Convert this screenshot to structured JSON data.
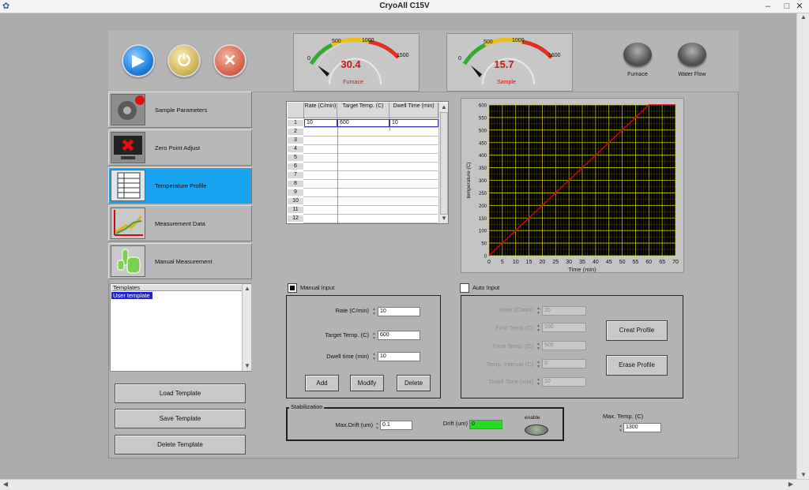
{
  "window": {
    "title": "CryoAll C15V"
  },
  "toolbar": {
    "run": "run",
    "power": "power",
    "stop": "stop"
  },
  "gauges": {
    "furnace": {
      "value": "30.4",
      "label": "Furnace",
      "ticks": [
        "0",
        "500",
        "1000",
        "1500"
      ],
      "reading": 30.4,
      "max": 1500
    },
    "sample": {
      "value": "15.7",
      "label": "Sample",
      "ticks": [
        "0",
        "500",
        "1000",
        "1600"
      ],
      "reading": 15.7,
      "max": 1600
    }
  },
  "indicators": {
    "furnace": "Furnace",
    "water_flow": "Water Flow"
  },
  "nav": {
    "items": [
      {
        "label": "Sample Parameters"
      },
      {
        "label": "Zero Point Adjust"
      },
      {
        "label": "Temperature Profile"
      },
      {
        "label": "Measurement Data"
      },
      {
        "label": "Manual Measurement"
      }
    ]
  },
  "templates": {
    "header": "Templates",
    "items": [
      "User template"
    ],
    "load": "Load Template",
    "save": "Save Template",
    "delete": "Delete Template"
  },
  "profile_table": {
    "headers": [
      "Rate (C/min)",
      "Target Temp. (C)",
      "Dwell Time (min)"
    ],
    "row_numbers": [
      "1",
      "2",
      "3",
      "4",
      "5",
      "6",
      "7",
      "8",
      "9",
      "10",
      "11",
      "12"
    ],
    "rows": [
      {
        "rate": "10",
        "target": "600",
        "dwell": "10"
      }
    ]
  },
  "chart_data": {
    "type": "line",
    "xlabel": "Time (min)",
    "ylabel": "temperature (C)",
    "xlim": [
      0,
      70
    ],
    "ylim": [
      0,
      600
    ],
    "x_ticks": [
      "0",
      "5",
      "10",
      "15",
      "20",
      "25",
      "30",
      "35",
      "40",
      "45",
      "50",
      "55",
      "60",
      "65",
      "70"
    ],
    "y_ticks": [
      "0",
      "50",
      "100",
      "150",
      "200",
      "250",
      "300",
      "350",
      "400",
      "450",
      "500",
      "550",
      "600"
    ],
    "grid": true,
    "background": "#000000",
    "grid_color": "#d8d800",
    "series": [
      {
        "color": "#e00000",
        "x": [
          0,
          60,
          70
        ],
        "y": [
          0,
          600,
          600
        ]
      }
    ]
  },
  "manual_input": {
    "title": "Manual Input",
    "rate_label": "Rate (C/min)",
    "rate_value": "10",
    "target_label": "Target Temp. (C)",
    "target_value": "600",
    "dwell_label": "Dwell time (min)",
    "dwell_value": "10",
    "add": "Add",
    "modify": "Modify",
    "delete": "Delete"
  },
  "auto_input": {
    "title": "Auto Input",
    "rate_label": "Rate (C/min)",
    "rate_value": "20",
    "first_temp_label": "First Temp.(C)",
    "first_temp_value": "100",
    "final_temp_label": "Final Temp. (C)",
    "final_temp_value": "500",
    "interval_label": "Temp. Interval (C)",
    "interval_value": "0",
    "dwell_label": "Dwell Time (min)",
    "dwell_value": "10",
    "create": "Creat Profile",
    "erase": "Erase Profile"
  },
  "stabilization": {
    "title": "Stabilization",
    "max_drift_label": "Max.Drift (um)",
    "max_drift_value": "0.1",
    "drift_label": "Drift (um)",
    "drift_value": "0",
    "enable_label": "enable"
  },
  "max_temp": {
    "label": "Max. Temp. (C)",
    "value": "1300"
  },
  "colors": {
    "active_nav": "#1aa3f0",
    "gauge_value": "#d01414",
    "drift_field": "#22dd22",
    "selection": "#2424cc"
  }
}
